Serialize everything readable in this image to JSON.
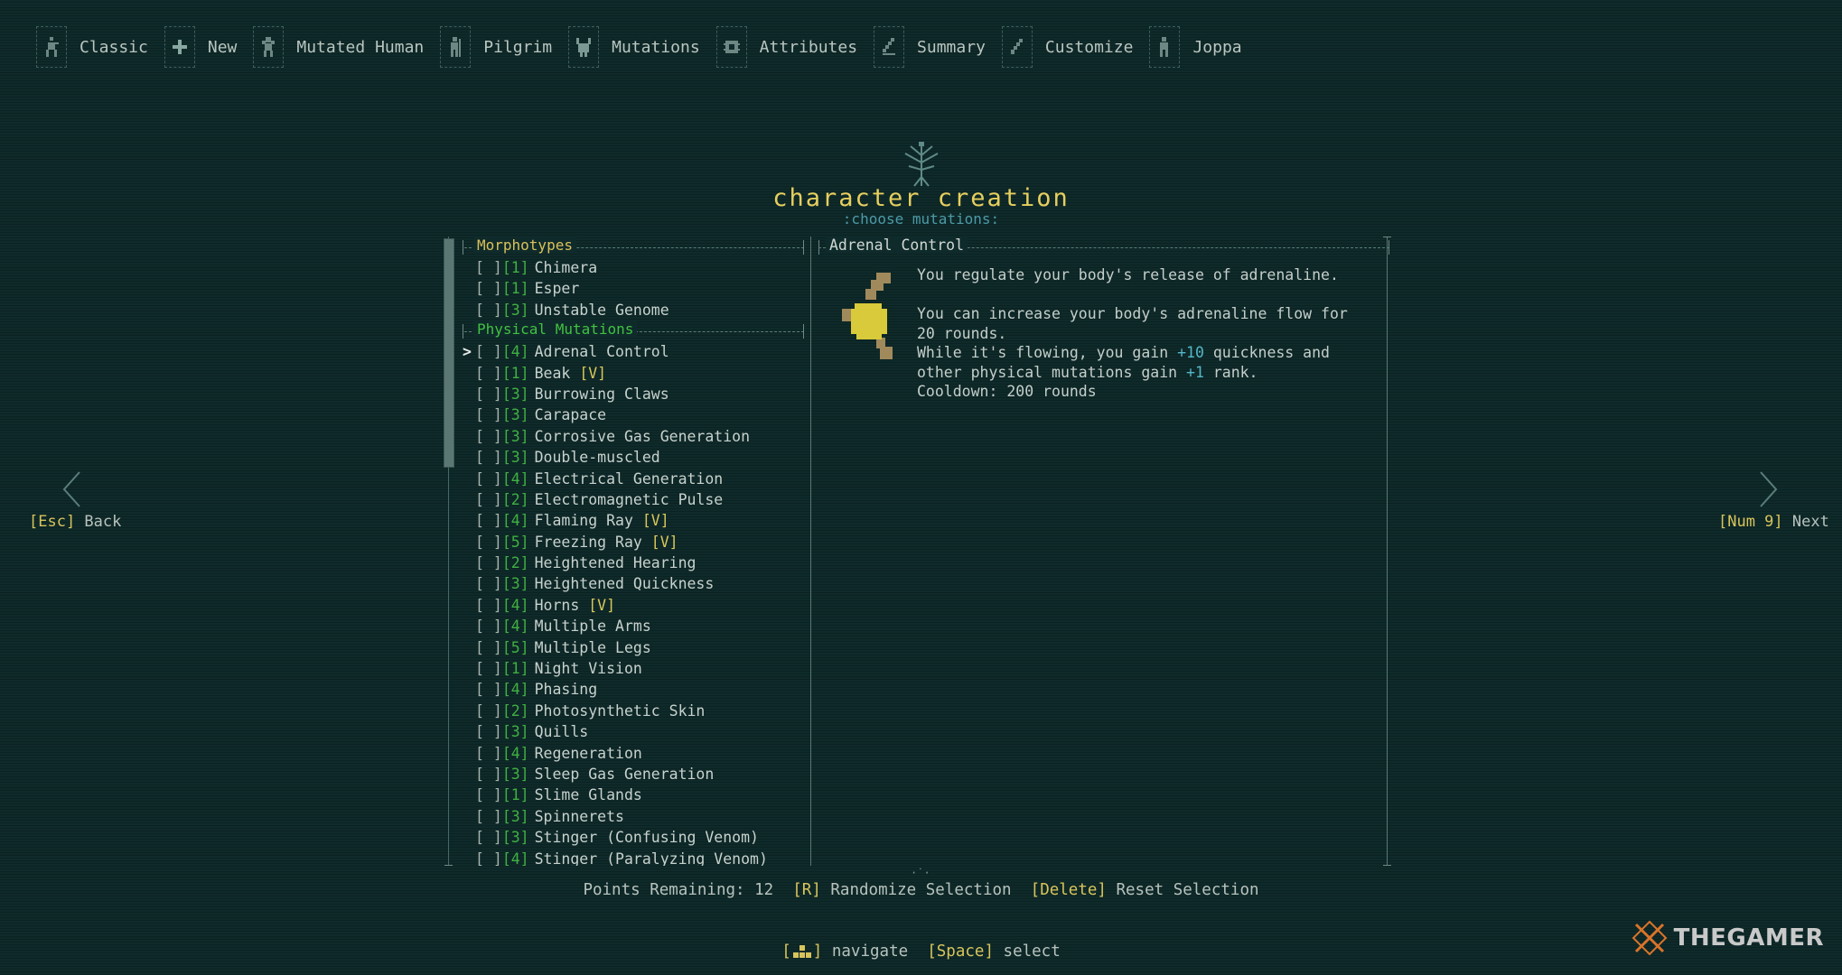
{
  "breadcrumbs": [
    {
      "label": "Classic",
      "icon": "classic-icon"
    },
    {
      "label": "New",
      "icon": "plus-icon"
    },
    {
      "label": "Mutated Human",
      "icon": "mutated-human-icon"
    },
    {
      "label": "Pilgrim",
      "icon": "pilgrim-icon"
    },
    {
      "label": "Mutations",
      "icon": "mutations-icon"
    },
    {
      "label": "Attributes",
      "icon": "attributes-icon"
    },
    {
      "label": "Summary",
      "icon": "summary-icon"
    },
    {
      "label": "Customize",
      "icon": "customize-icon"
    },
    {
      "label": "Joppa",
      "icon": "joppa-icon"
    }
  ],
  "header": {
    "title": "character creation",
    "subtitle": ":choose mutations:"
  },
  "morphotypes": {
    "heading": "Morphotypes",
    "items": [
      {
        "box": "[ ]",
        "cost": "[1]",
        "name": "Chimera"
      },
      {
        "box": "[ ]",
        "cost": "[1]",
        "name": "Esper"
      },
      {
        "box": "[ ]",
        "cost": "[3]",
        "name": "Unstable Genome"
      }
    ]
  },
  "physical": {
    "heading": "Physical Mutations",
    "items": [
      {
        "box": "[ ]",
        "cost": "[4]",
        "name": "Adrenal Control",
        "selected": true
      },
      {
        "box": "[ ]",
        "cost": "[1]",
        "name": "Beak",
        "tag": "[V]"
      },
      {
        "box": "[ ]",
        "cost": "[3]",
        "name": "Burrowing Claws"
      },
      {
        "box": "[ ]",
        "cost": "[3]",
        "name": "Carapace"
      },
      {
        "box": "[ ]",
        "cost": "[3]",
        "name": "Corrosive Gas Generation"
      },
      {
        "box": "[ ]",
        "cost": "[3]",
        "name": "Double-muscled"
      },
      {
        "box": "[ ]",
        "cost": "[4]",
        "name": "Electrical Generation"
      },
      {
        "box": "[ ]",
        "cost": "[2]",
        "name": "Electromagnetic Pulse"
      },
      {
        "box": "[ ]",
        "cost": "[4]",
        "name": "Flaming Ray",
        "tag": "[V]"
      },
      {
        "box": "[ ]",
        "cost": "[5]",
        "name": "Freezing Ray",
        "tag": "[V]"
      },
      {
        "box": "[ ]",
        "cost": "[2]",
        "name": "Heightened Hearing"
      },
      {
        "box": "[ ]",
        "cost": "[3]",
        "name": "Heightened Quickness"
      },
      {
        "box": "[ ]",
        "cost": "[4]",
        "name": "Horns",
        "tag": "[V]"
      },
      {
        "box": "[ ]",
        "cost": "[4]",
        "name": "Multiple Arms"
      },
      {
        "box": "[ ]",
        "cost": "[5]",
        "name": "Multiple Legs"
      },
      {
        "box": "[ ]",
        "cost": "[1]",
        "name": "Night Vision"
      },
      {
        "box": "[ ]",
        "cost": "[4]",
        "name": "Phasing"
      },
      {
        "box": "[ ]",
        "cost": "[2]",
        "name": "Photosynthetic Skin"
      },
      {
        "box": "[ ]",
        "cost": "[3]",
        "name": "Quills"
      },
      {
        "box": "[ ]",
        "cost": "[4]",
        "name": "Regeneration"
      },
      {
        "box": "[ ]",
        "cost": "[3]",
        "name": "Sleep Gas Generation"
      },
      {
        "box": "[ ]",
        "cost": "[1]",
        "name": "Slime Glands"
      },
      {
        "box": "[ ]",
        "cost": "[3]",
        "name": "Spinnerets"
      },
      {
        "box": "[ ]",
        "cost": "[3]",
        "name": "Stinger (Confusing Venom)"
      },
      {
        "box": "[ ]",
        "cost": "[4]",
        "name": "Stinger (Paralyzing Venom)"
      }
    ]
  },
  "detail": {
    "title": "Adrenal Control",
    "line1": "You regulate your body's release of adrenaline.",
    "line2": "You can increase your body's adrenaline flow for",
    "line3": "20 rounds.",
    "line4a": "While it's flowing, you gain ",
    "line4num": "+10",
    "line4b": " quickness and",
    "line5a": "other physical mutations gain ",
    "line5num": "+1",
    "line5b": " rank.",
    "line6": "Cooldown: 200 rounds"
  },
  "nav": {
    "back_key": "[Esc]",
    "back_label": " Back",
    "next_key": "[Num 9]",
    "next_label": " Next"
  },
  "bottom": {
    "points_label": "Points Remaining: 12",
    "randomize_key": "[R]",
    "randomize_label": " Randomize Selection",
    "reset_key": "[Delete]",
    "reset_label": " Reset Selection"
  },
  "hints": {
    "navigate_label": " navigate",
    "select_key": "[Space]",
    "select_label": " select"
  },
  "watermark": {
    "text": "THEGAMER"
  },
  "colors": {
    "background": "#0f2a2a",
    "title_yellow": "#e6cf5e",
    "key_yellow": "#d7c45c",
    "cost_green": "#40b042",
    "subtitle_cyan": "#4c9aa7"
  }
}
